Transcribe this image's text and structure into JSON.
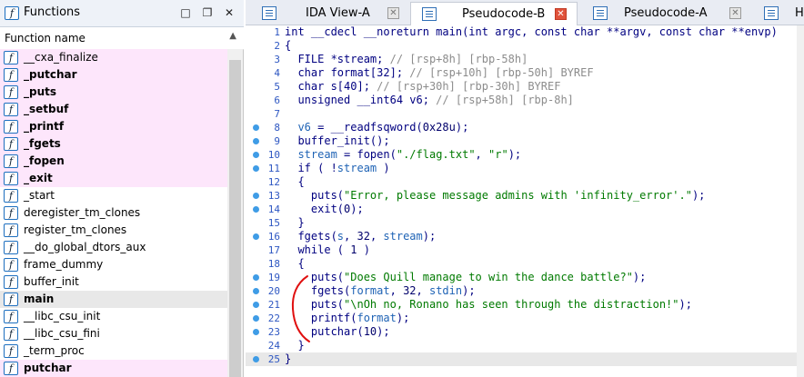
{
  "functions_panel": {
    "title": "Functions",
    "column_header": "Function name",
    "items": [
      {
        "name": "__cxa_finalize",
        "style": "pink"
      },
      {
        "name": "_putchar",
        "style": "pink-bold"
      },
      {
        "name": "_puts",
        "style": "pink-bold"
      },
      {
        "name": "_setbuf",
        "style": "pink-bold"
      },
      {
        "name": "_printf",
        "style": "pink-bold"
      },
      {
        "name": "_fgets",
        "style": "pink-bold"
      },
      {
        "name": "_fopen",
        "style": "pink-bold"
      },
      {
        "name": "_exit",
        "style": "pink-bold"
      },
      {
        "name": "_start",
        "style": "normal"
      },
      {
        "name": "deregister_tm_clones",
        "style": "normal"
      },
      {
        "name": "register_tm_clones",
        "style": "normal"
      },
      {
        "name": "__do_global_dtors_aux",
        "style": "normal"
      },
      {
        "name": "frame_dummy",
        "style": "normal"
      },
      {
        "name": "buffer_init",
        "style": "normal"
      },
      {
        "name": "main",
        "style": "selected-bold"
      },
      {
        "name": "__libc_csu_init",
        "style": "normal"
      },
      {
        "name": "__libc_csu_fini",
        "style": "normal"
      },
      {
        "name": "_term_proc",
        "style": "normal"
      },
      {
        "name": "putchar",
        "style": "pink-bold"
      }
    ]
  },
  "tabs": [
    {
      "label": "IDA View-A",
      "active": false
    },
    {
      "label": "Pseudocode-B",
      "active": true
    },
    {
      "label": "Pseudocode-A",
      "active": false
    },
    {
      "label": "H",
      "active": false
    }
  ],
  "code_lines": [
    {
      "n": "1",
      "bp": false,
      "html": "int __cdecl __noreturn main(int argc, const char **argv, const char **envp)"
    },
    {
      "n": "2",
      "bp": false,
      "html": "{"
    },
    {
      "n": "3",
      "bp": false,
      "html": "  FILE *stream; <span class='c'>// [rsp+8h] [rbp-58h]</span>"
    },
    {
      "n": "4",
      "bp": false,
      "html": "  char format[32]; <span class='c'>// [rsp+10h] [rbp-50h] BYREF</span>"
    },
    {
      "n": "5",
      "bp": false,
      "html": "  char s[40]; <span class='c'>// [rsp+30h] [rbp-30h] BYREF</span>"
    },
    {
      "n": "6",
      "bp": false,
      "html": "  unsigned __int64 v6; <span class='c'>// [rsp+58h] [rbp-8h]</span>"
    },
    {
      "n": "7",
      "bp": false,
      "html": ""
    },
    {
      "n": "8",
      "bp": true,
      "html": "  <span class='v'>v6</span> = __readfsqword(<span class='n'>0x28u</span>);"
    },
    {
      "n": "9",
      "bp": true,
      "html": "  buffer_init();"
    },
    {
      "n": "10",
      "bp": true,
      "html": "  <span class='v'>stream</span> = fopen(<span class='s'>\"./flag.txt\"</span>, <span class='s'>\"r\"</span>);"
    },
    {
      "n": "11",
      "bp": true,
      "html": "  if ( !<span class='v'>stream</span> )"
    },
    {
      "n": "12",
      "bp": false,
      "html": "  {"
    },
    {
      "n": "13",
      "bp": true,
      "html": "    puts(<span class='s'>\"Error, please message admins with 'infinity_error'.\"</span>);"
    },
    {
      "n": "14",
      "bp": true,
      "html": "    exit(<span class='n'>0</span>);"
    },
    {
      "n": "15",
      "bp": false,
      "html": "  }"
    },
    {
      "n": "16",
      "bp": true,
      "html": "  fgets(<span class='v'>s</span>, <span class='n'>32</span>, <span class='v'>stream</span>);"
    },
    {
      "n": "17",
      "bp": false,
      "html": "  while ( <span class='n'>1</span> )"
    },
    {
      "n": "18",
      "bp": false,
      "html": "  {"
    },
    {
      "n": "19",
      "bp": true,
      "html": "    puts(<span class='s'>\"Does Quill manage to win the dance battle?\"</span>);"
    },
    {
      "n": "20",
      "bp": true,
      "html": "    fgets(<span class='v'>format</span>, <span class='n'>32</span>, <span class='v'>stdin</span>);"
    },
    {
      "n": "21",
      "bp": true,
      "html": "    puts(<span class='s'>\"\\nOh no, Ronano has seen through the distraction!\"</span>);"
    },
    {
      "n": "22",
      "bp": true,
      "html": "    printf(<span class='v'>format</span>);"
    },
    {
      "n": "23",
      "bp": true,
      "html": "    putchar(<span class='n'>10</span>);"
    },
    {
      "n": "24",
      "bp": false,
      "html": "  }"
    },
    {
      "n": "25",
      "bp": true,
      "html": "}"
    }
  ],
  "colors": {
    "breakpoint": "#3f9ce6",
    "annotation": "#e01010",
    "import_highlight": "#fde6fb"
  }
}
